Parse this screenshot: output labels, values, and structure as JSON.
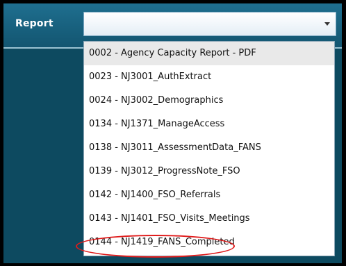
{
  "form": {
    "report_label": "Report",
    "select_value": ""
  },
  "dropdown": {
    "options": [
      "0002 - Agency Capacity Report - PDF",
      "0023 - NJ3001_AuthExtract",
      "0024 - NJ3002_Demographics",
      "0134 - NJ1371_ManageAccess",
      "0138 - NJ3011_AssessmentData_FANS",
      "0139 - NJ3012_ProgressNote_FSO",
      "0142 - NJ1400_FSO_Referrals",
      "0143 - NJ1401_FSO_Visits_Meetings",
      "0144 - NJ1419_FANS_Completed"
    ],
    "highlighted_option_index": 0,
    "annotated_option_index": 8
  },
  "colors": {
    "panel": "#0d4a60",
    "header": "#175f7c",
    "annotation": "#e01b1b"
  },
  "icons": {
    "select_arrow": "chevron-down-icon"
  }
}
